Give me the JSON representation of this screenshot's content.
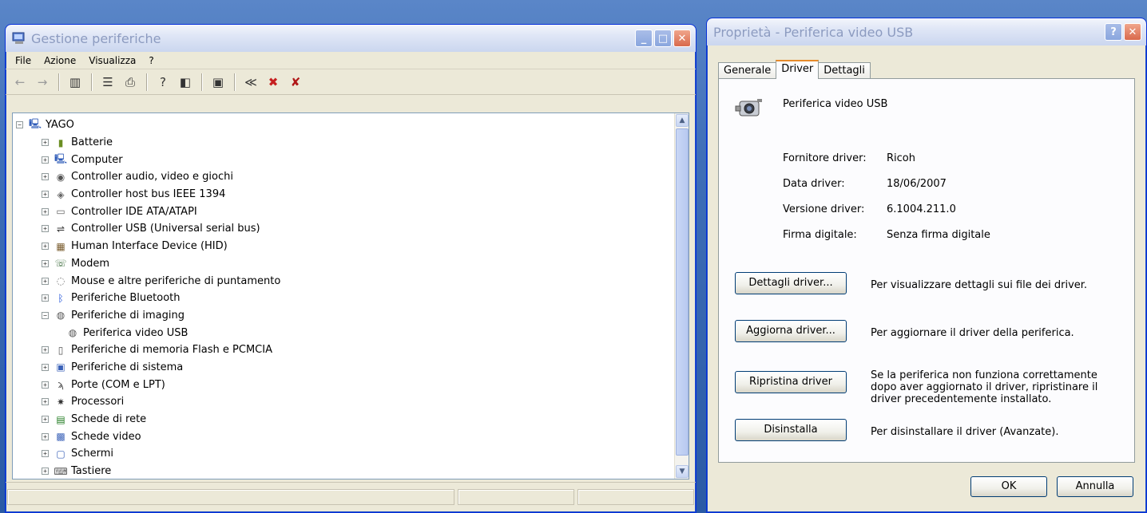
{
  "device_manager": {
    "title": "Gestione periferiche",
    "menu": [
      "File",
      "Azione",
      "Visualizza",
      "?"
    ],
    "tree": [
      {
        "label": "YAGO",
        "level": 0,
        "expander": "−",
        "icon": "computer-icon"
      },
      {
        "label": "Batterie",
        "level": 1,
        "expander": "+",
        "icon": "battery-icon"
      },
      {
        "label": "Computer",
        "level": 1,
        "expander": "+",
        "icon": "computer-icon"
      },
      {
        "label": "Controller audio, video e giochi",
        "level": 1,
        "expander": "+",
        "icon": "speaker-icon"
      },
      {
        "label": "Controller host bus IEEE 1394",
        "level": 1,
        "expander": "+",
        "icon": "controller-icon"
      },
      {
        "label": "Controller IDE ATA/ATAPI",
        "level": 1,
        "expander": "+",
        "icon": "disk-controller-icon"
      },
      {
        "label": "Controller USB (Universal serial bus)",
        "level": 1,
        "expander": "+",
        "icon": "usb-icon"
      },
      {
        "label": "Human Interface Device (HID)",
        "level": 1,
        "expander": "+",
        "icon": "hid-icon"
      },
      {
        "label": "Modem",
        "level": 1,
        "expander": "+",
        "icon": "modem-icon"
      },
      {
        "label": "Mouse e altre periferiche di puntamento",
        "level": 1,
        "expander": "+",
        "icon": "mouse-icon"
      },
      {
        "label": "Periferiche Bluetooth",
        "level": 1,
        "expander": "+",
        "icon": "bluetooth-icon"
      },
      {
        "label": "Periferiche di imaging",
        "level": 1,
        "expander": "−",
        "icon": "camera-icon"
      },
      {
        "label": "Periferica video USB",
        "level": 2,
        "expander": "",
        "icon": "camera-icon"
      },
      {
        "label": "Periferiche di memoria Flash e PCMCIA",
        "level": 1,
        "expander": "+",
        "icon": "flash-memory-icon"
      },
      {
        "label": "Periferiche di sistema",
        "level": 1,
        "expander": "+",
        "icon": "system-device-icon"
      },
      {
        "label": "Porte (COM e LPT)",
        "level": 1,
        "expander": "+",
        "icon": "port-icon"
      },
      {
        "label": "Processori",
        "level": 1,
        "expander": "+",
        "icon": "processor-icon"
      },
      {
        "label": "Schede di rete",
        "level": 1,
        "expander": "+",
        "icon": "network-card-icon"
      },
      {
        "label": "Schede video",
        "level": 1,
        "expander": "+",
        "icon": "display-adapter-icon"
      },
      {
        "label": "Schermi",
        "level": 1,
        "expander": "+",
        "icon": "monitor-icon"
      },
      {
        "label": "Tastiere",
        "level": 1,
        "expander": "+",
        "icon": "keyboard-icon"
      }
    ]
  },
  "properties": {
    "title": "Proprietà - Periferica video USB",
    "tabs": [
      "Generale",
      "Driver",
      "Dettagli"
    ],
    "active_tab": "Driver",
    "device_name": "Periferica video USB",
    "info": [
      {
        "label": "Fornitore driver:",
        "value": "Ricoh"
      },
      {
        "label": "Data driver:",
        "value": "18/06/2007"
      },
      {
        "label": "Versione driver:",
        "value": "6.1004.211.0"
      },
      {
        "label": "Firma digitale:",
        "value": "Senza firma digitale"
      }
    ],
    "actions": [
      {
        "button": "Dettagli driver...",
        "description": "Per visualizzare dettagli sui file dei driver."
      },
      {
        "button": "Aggiorna driver...",
        "description": "Per aggiornare il driver della periferica."
      },
      {
        "button": "Ripristina driver",
        "description": "Se la periferica non funziona correttamente dopo aver aggiornato il driver, ripristinare il driver precedentemente installato."
      },
      {
        "button": "Disinstalla",
        "description": "Per disinstallare il driver (Avanzate)."
      }
    ],
    "ok_label": "OK",
    "cancel_label": "Annulla"
  },
  "colors": {
    "accent_tab": "#e68b2c",
    "titlebar_inactive_text": "#8c9bc0"
  }
}
